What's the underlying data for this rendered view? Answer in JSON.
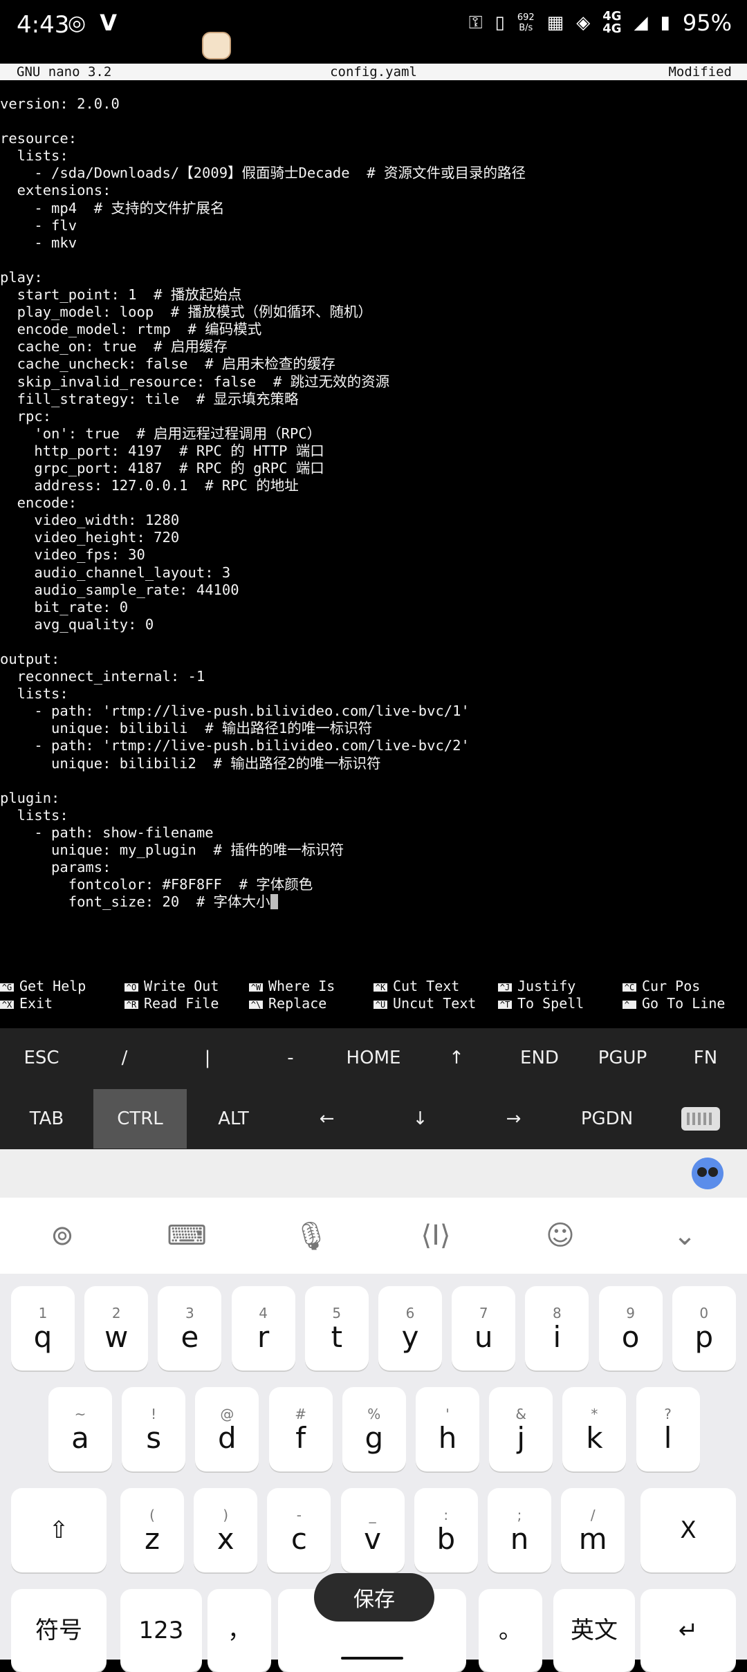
{
  "status_bar": {
    "time": "4:43",
    "net_speed_top": "692",
    "net_speed_bottom": "B/s",
    "net_type_top": "4G",
    "net_type_bottom": "4G",
    "battery": "95%",
    "icons": [
      "browser-icon",
      "v-app-icon",
      "key-icon",
      "vibrate-icon",
      "nfc-icon",
      "wifi-icon",
      "signal-icon",
      "battery-icon"
    ]
  },
  "nano": {
    "app": "GNU nano 3.2",
    "filename": "config.yaml",
    "state": "Modified",
    "lines": [
      "version: 2.0.0",
      "",
      "resource:",
      "  lists:",
      "    - /sda/Downloads/【2009】假面骑士Decade  # 资源文件或目录的路径",
      "  extensions:",
      "    - mp4  # 支持的文件扩展名",
      "    - flv",
      "    - mkv",
      "",
      "play:",
      "  start_point: 1  # 播放起始点",
      "  play_model: loop  # 播放模式（例如循环、随机）",
      "  encode_model: rtmp  # 编码模式",
      "  cache_on: true  # 启用缓存",
      "  cache_uncheck: false  # 启用未检查的缓存",
      "  skip_invalid_resource: false  # 跳过无效的资源",
      "  fill_strategy: tile  # 显示填充策略",
      "  rpc:",
      "    'on': true  # 启用远程过程调用（RPC）",
      "    http_port: 4197  # RPC 的 HTTP 端口",
      "    grpc_port: 4187  # RPC 的 gRPC 端口",
      "    address: 127.0.0.1  # RPC 的地址",
      "  encode:",
      "    video_width: 1280",
      "    video_height: 720",
      "    video_fps: 30",
      "    audio_channel_layout: 3",
      "    audio_sample_rate: 44100",
      "    bit_rate: 0",
      "    avg_quality: 0",
      "",
      "output:",
      "  reconnect_internal: -1",
      "  lists:",
      "    - path: 'rtmp://live-push.bilivideo.com/live-bvc/1'",
      "      unique: bilibili  # 输出路径1的唯一标识符",
      "    - path: 'rtmp://live-push.bilivideo.com/live-bvc/2'",
      "      unique: bilibili2  # 输出路径2的唯一标识符",
      "",
      "plugin:",
      "  lists:",
      "    - path: show-filename",
      "      unique: my_plugin  # 插件的唯一标识符",
      "      params:",
      "        fontcolor: #F8F8FF  # 字体颜色",
      "        font_size: 20  # 字体大小"
    ],
    "shortcuts": [
      [
        {
          "key": "^G",
          "label": "Get Help"
        },
        {
          "key": "^X",
          "label": "Exit"
        }
      ],
      [
        {
          "key": "^O",
          "label": "Write Out"
        },
        {
          "key": "^R",
          "label": "Read File"
        }
      ],
      [
        {
          "key": "^W",
          "label": "Where Is"
        },
        {
          "key": "^\\",
          "label": "Replace"
        }
      ],
      [
        {
          "key": "^K",
          "label": "Cut Text"
        },
        {
          "key": "^U",
          "label": "Uncut Text"
        }
      ],
      [
        {
          "key": "^J",
          "label": "Justify"
        },
        {
          "key": "^T",
          "label": "To Spell"
        }
      ],
      [
        {
          "key": "^C",
          "label": "Cur Pos"
        },
        {
          "key": "^_",
          "label": "Go To Line"
        }
      ]
    ]
  },
  "extra_keys": {
    "row1": [
      "ESC",
      "/",
      "|",
      "-",
      "HOME",
      "↑",
      "END",
      "PGUP",
      "FN"
    ],
    "row2": [
      "TAB",
      "CTRL",
      "ALT",
      "←",
      "↓",
      "→",
      "PGDN",
      "keyboard-icon"
    ],
    "active": "CTRL"
  },
  "ime": {
    "toolbar": [
      "ime-logo-icon",
      "clipboard-icon",
      "microphone-icon",
      "cursor-icon",
      "emoji-icon",
      "collapse-icon"
    ],
    "row1": [
      [
        "1",
        "q"
      ],
      [
        "2",
        "w"
      ],
      [
        "3",
        "e"
      ],
      [
        "4",
        "r"
      ],
      [
        "5",
        "t"
      ],
      [
        "6",
        "y"
      ],
      [
        "7",
        "u"
      ],
      [
        "8",
        "i"
      ],
      [
        "9",
        "o"
      ],
      [
        "0",
        "p"
      ]
    ],
    "row2": [
      [
        "~",
        "a"
      ],
      [
        "!",
        "s"
      ],
      [
        "@",
        "d"
      ],
      [
        "#",
        "f"
      ],
      [
        "%",
        "g"
      ],
      [
        "'",
        "h"
      ],
      [
        "&",
        "j"
      ],
      [
        "*",
        "k"
      ],
      [
        "?",
        "l"
      ]
    ],
    "row3": [
      [
        "(",
        "z"
      ],
      [
        ")",
        "x"
      ],
      [
        "-",
        "c"
      ],
      [
        "_",
        "v"
      ],
      [
        ":",
        "b"
      ],
      [
        ";",
        "n"
      ],
      [
        "/",
        "m"
      ]
    ],
    "shift": "⇧",
    "delete": "X",
    "bottom": {
      "symbols": "符号",
      "numbers": "123",
      "comma": "，",
      "period": "。",
      "lang": "英文",
      "enter": "↵"
    },
    "toast": "保存"
  },
  "colors": {
    "terminal_bg": "#000000",
    "extra_keys_bg": "#222222",
    "ime_bg": "#ececef",
    "active_key": "#555555"
  }
}
